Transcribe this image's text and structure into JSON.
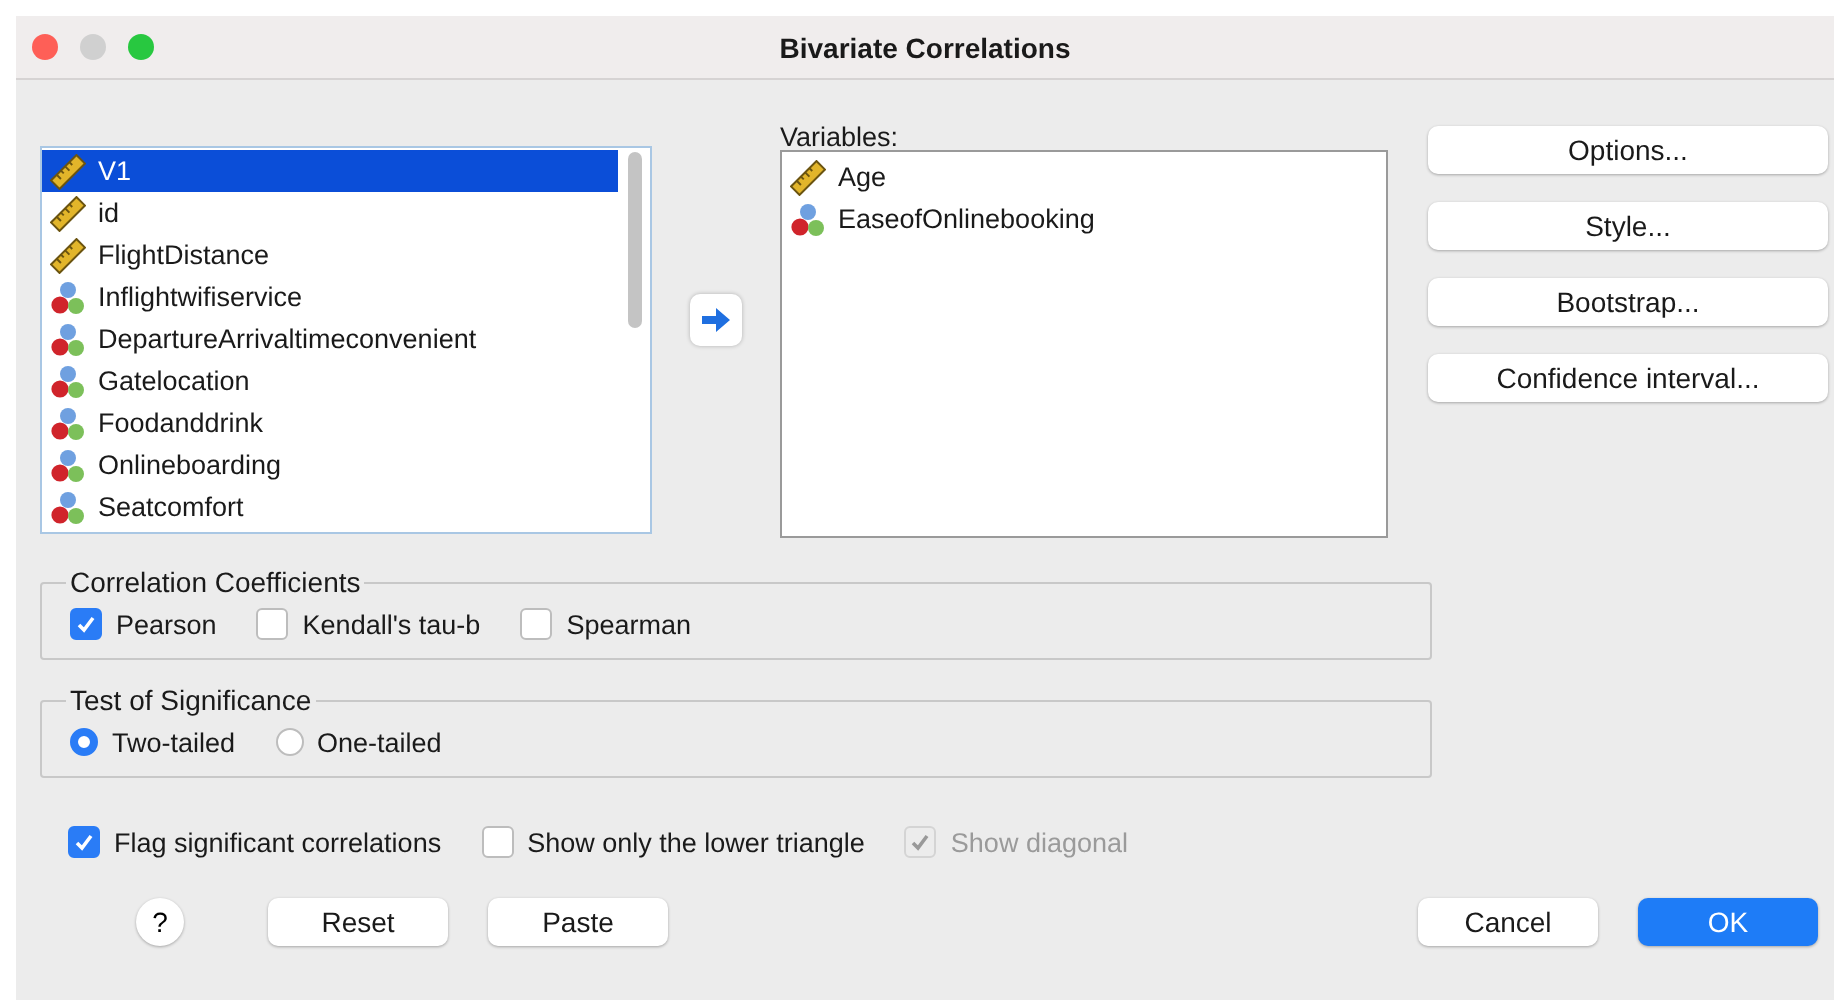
{
  "window": {
    "title": "Bivariate Correlations"
  },
  "source_list": {
    "items": [
      {
        "name": "V1",
        "kind": "scale",
        "selected": true
      },
      {
        "name": "id",
        "kind": "scale",
        "selected": false
      },
      {
        "name": "FlightDistance",
        "kind": "scale",
        "selected": false
      },
      {
        "name": "Inflightwifiservice",
        "kind": "ordinal",
        "selected": false
      },
      {
        "name": "DepartureArrivaltimeconvenient",
        "kind": "ordinal",
        "selected": false
      },
      {
        "name": "Gatelocation",
        "kind": "ordinal",
        "selected": false
      },
      {
        "name": "Foodanddrink",
        "kind": "ordinal",
        "selected": false
      },
      {
        "name": "Onlineboarding",
        "kind": "ordinal",
        "selected": false
      },
      {
        "name": "Seatcomfort",
        "kind": "ordinal",
        "selected": false
      }
    ]
  },
  "variables": {
    "label": "Variables:",
    "items": [
      {
        "name": "Age",
        "kind": "scale"
      },
      {
        "name": "EaseofOnlinebooking",
        "kind": "ordinal"
      }
    ]
  },
  "side_buttons": [
    "Options...",
    "Style...",
    "Bootstrap...",
    "Confidence interval..."
  ],
  "correlation_coefficients": {
    "title": "Correlation Coefficients",
    "options": [
      {
        "label": "Pearson",
        "checked": true
      },
      {
        "label": "Kendall's tau-b",
        "checked": false
      },
      {
        "label": "Spearman",
        "checked": false
      }
    ]
  },
  "test_of_significance": {
    "title": "Test of Significance",
    "options": [
      {
        "label": "Two-tailed",
        "selected": true
      },
      {
        "label": "One-tailed",
        "selected": false
      }
    ]
  },
  "flags": [
    {
      "label": "Flag significant correlations",
      "checked": true,
      "disabled": false
    },
    {
      "label": "Show only the lower triangle",
      "checked": false,
      "disabled": false
    },
    {
      "label": "Show diagonal",
      "checked": true,
      "disabled": true
    }
  ],
  "footer": {
    "help": "?",
    "left_buttons": [
      "Reset",
      "Paste"
    ],
    "cancel": "Cancel",
    "ok": "OK"
  }
}
